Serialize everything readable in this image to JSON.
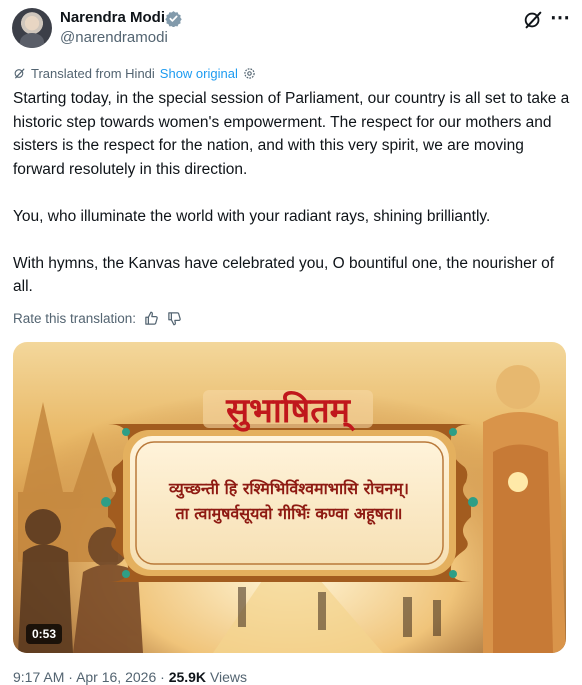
{
  "author": {
    "name": "Narendra Modi",
    "handle": "@narendramodi"
  },
  "translation": {
    "notice": "Translated from Hindi",
    "show_original": "Show original",
    "rate_label": "Rate this translation:"
  },
  "tweet": {
    "paragraphs": [
      "Starting today, in the special session of Parliament, our country is all set to take a historic step towards women's empowerment. The respect for our mothers and sisters is the respect for the nation, and with this very spirit, we are moving forward resolutely in this direction.",
      "You, who illuminate the world with your radiant rays, shining brilliantly.",
      "With hymns, the Kanvas have celebrated you, O bountiful one, the nourisher of all."
    ]
  },
  "media": {
    "title": "सुभाषितम्",
    "verse_line1": "व्युच्छन्ती हि रश्मिभिर्विश्वमाभासि रोचनम्।",
    "verse_line2": "ता त्वामुषर्वसूयवो गीर्भिः कण्वा अहूषत॥",
    "duration": "0:53"
  },
  "meta": {
    "time": "9:17 AM",
    "separator": "·",
    "date": "Apr 16, 2026",
    "views_count": "25.9K",
    "views_label": "Views"
  },
  "colors": {
    "link": "#1d9bf0",
    "verified": "#829aab",
    "secondary_text": "#536471",
    "title_red": "#c0171c"
  },
  "icons": [
    "verified-badge-icon",
    "grok-icon",
    "more-icon",
    "translate-icon",
    "settings-icon",
    "thumbs-up-icon",
    "thumbs-down-icon"
  ]
}
